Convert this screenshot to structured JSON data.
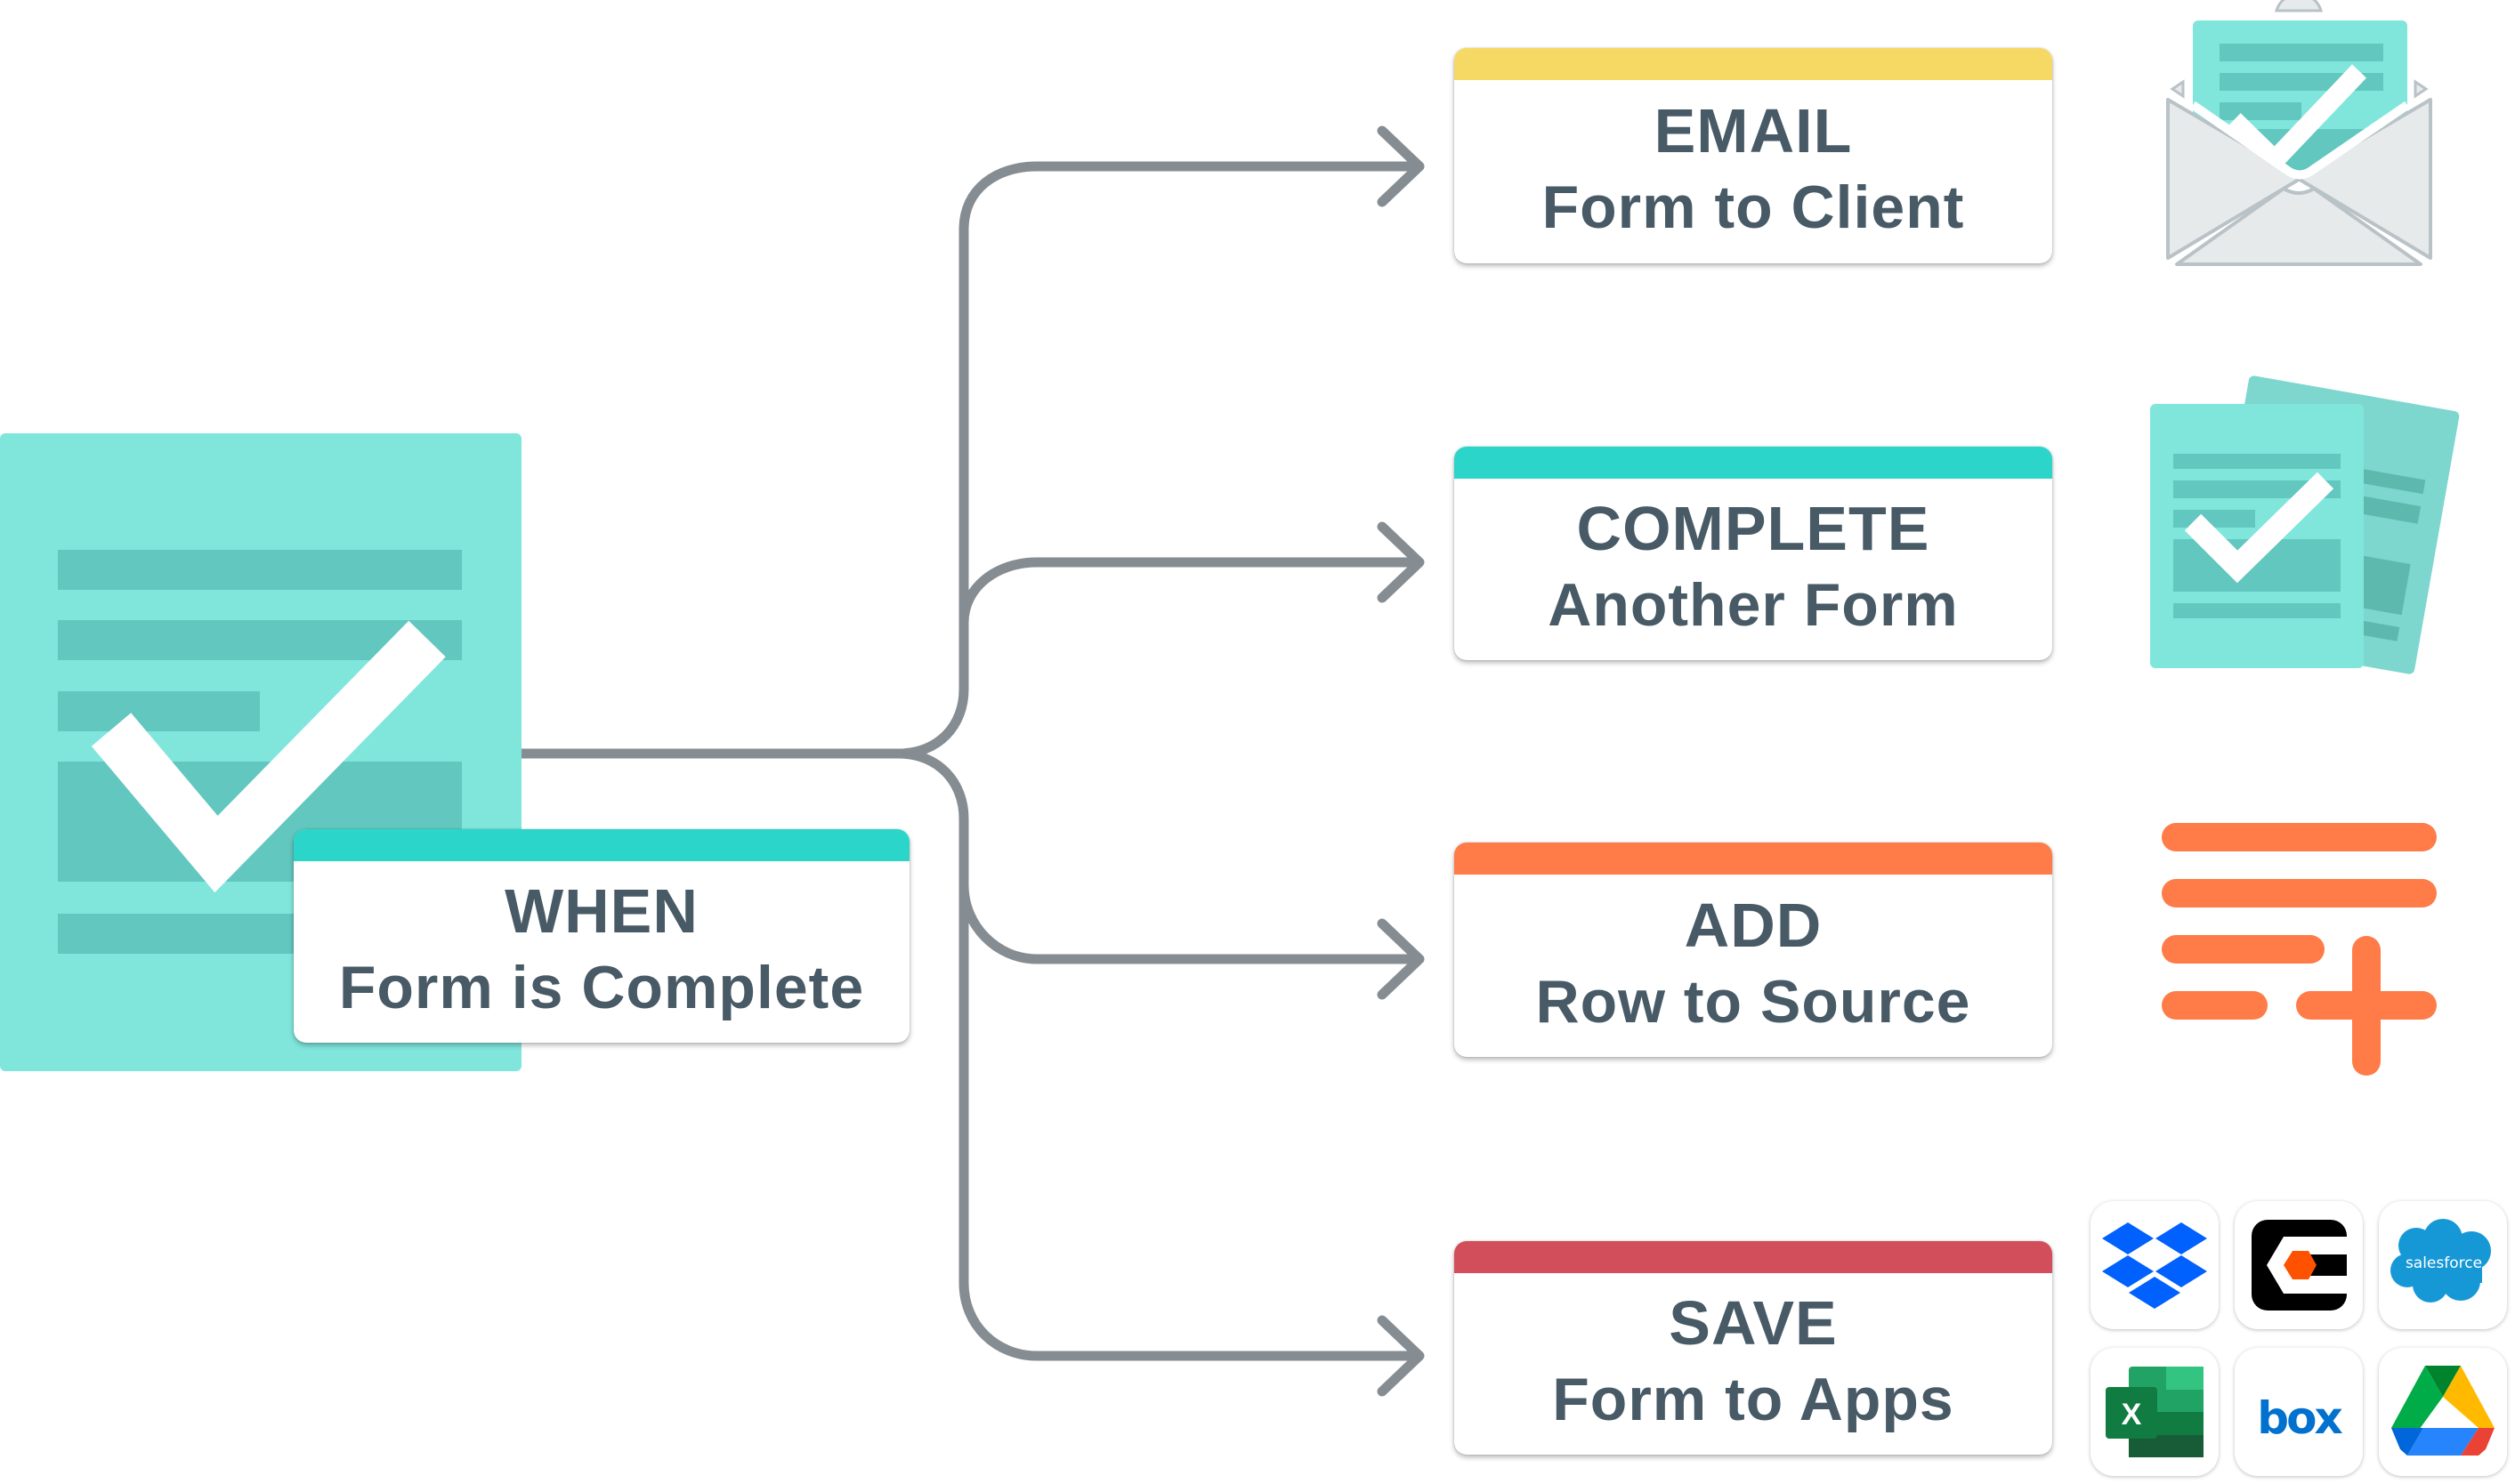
{
  "trigger": {
    "title": "WHEN",
    "subtitle": "Form is Complete",
    "accent": "#2CD5C9",
    "icon": "completed-form-icon"
  },
  "actions": [
    {
      "title": "EMAIL",
      "subtitle": "Form to Client",
      "accent": "#F5D964",
      "icon": "envelope-form-icon"
    },
    {
      "title": "COMPLETE",
      "subtitle": "Another Form",
      "accent": "#2CD5C9",
      "icon": "multiple-forms-icon"
    },
    {
      "title": "ADD",
      "subtitle": "Row to Source",
      "accent": "#FF7B47",
      "icon": "add-row-icon"
    },
    {
      "title": "SAVE",
      "subtitle": "Form to Apps",
      "accent": "#D24E5A",
      "icon": "app-integrations-icon"
    }
  ],
  "apps": [
    {
      "name": "Dropbox",
      "icon": "dropbox-icon"
    },
    {
      "name": "Procore",
      "icon": "procore-icon"
    },
    {
      "name": "Salesforce",
      "icon": "salesforce-icon",
      "label": "salesforce"
    },
    {
      "name": "Excel",
      "icon": "excel-icon",
      "label": "X"
    },
    {
      "name": "Box",
      "icon": "box-icon",
      "label": "box"
    },
    {
      "name": "Google Drive",
      "icon": "google-drive-icon"
    }
  ],
  "colors": {
    "text": "#485A66",
    "connector": "#858D93",
    "doc_fill": "#80E6DC",
    "doc_lines": "#62C7BF",
    "doc_back": "#7DD7CE",
    "envelope_fill": "#E6EAEB",
    "envelope_stroke": "#B9C2C6",
    "add_row": "#FF7B47"
  }
}
